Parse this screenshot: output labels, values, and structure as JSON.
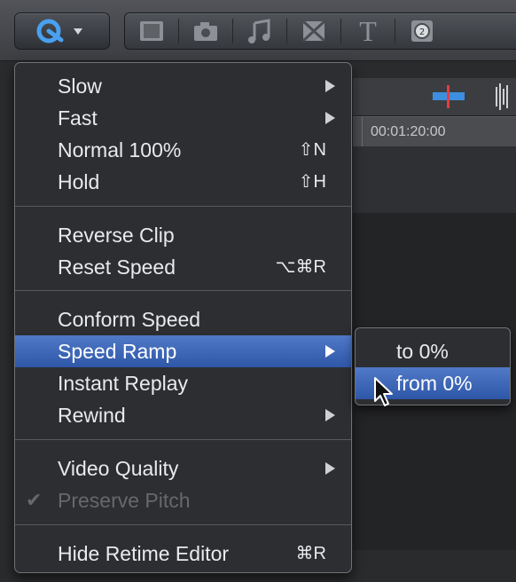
{
  "toolbar": {
    "retime_icon": "retime-icon",
    "media_icons": [
      "filmstrip-icon",
      "camera-icon",
      "music-note-icon",
      "transition-icon",
      "title-icon",
      "generator-icon"
    ],
    "title_glyph": "T"
  },
  "timeline": {
    "timecode": "00:01:20:00"
  },
  "menu": {
    "items": [
      {
        "label": "Slow",
        "submenu": true
      },
      {
        "label": "Fast",
        "submenu": true
      },
      {
        "label": "Normal 100%",
        "shortcut": "⇧N"
      },
      {
        "label": "Hold",
        "shortcut": "⇧H"
      },
      {
        "label": "Reverse Clip"
      },
      {
        "label": "Reset Speed",
        "shortcut": "⌥⌘R"
      },
      {
        "label": "Conform Speed"
      },
      {
        "label": "Speed Ramp",
        "submenu": true,
        "highlighted": true
      },
      {
        "label": "Instant Replay"
      },
      {
        "label": "Rewind",
        "submenu": true
      },
      {
        "label": "Video Quality",
        "submenu": true
      },
      {
        "label": "Preserve Pitch",
        "checked": true,
        "disabled": true,
        "check": "✔"
      },
      {
        "label": "Hide Retime Editor",
        "shortcut": "⌘R"
      }
    ]
  },
  "submenu": {
    "items": [
      {
        "label": "to 0%"
      },
      {
        "label": "from 0%",
        "highlighted": true
      }
    ]
  },
  "colors": {
    "highlight": "#3a63b6",
    "retime_accent": "#4aa0f0"
  }
}
